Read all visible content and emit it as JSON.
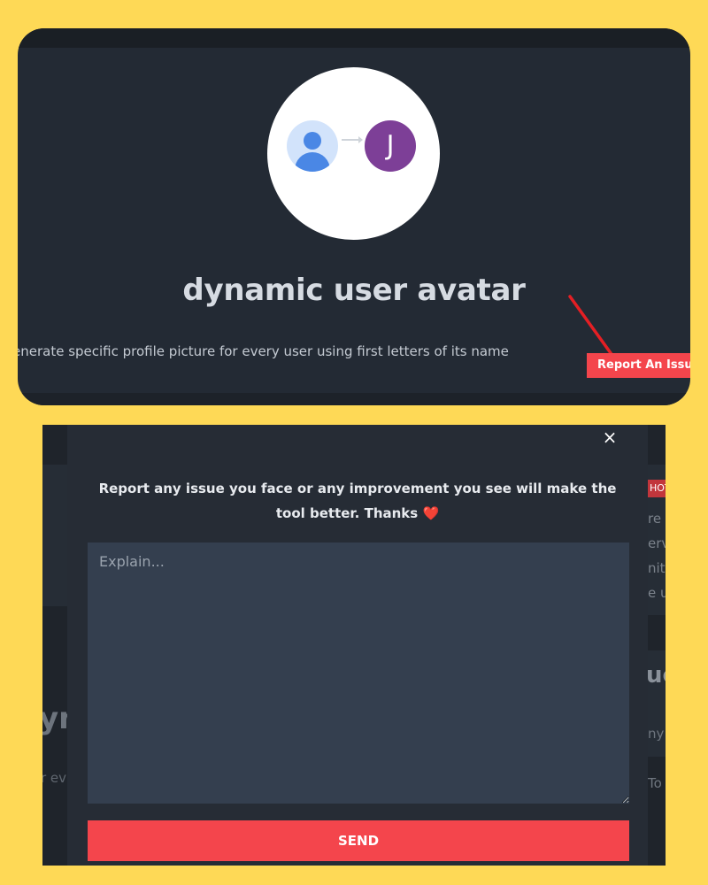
{
  "tool_card": {
    "title": "dynamic user avatar",
    "description": "enerate specific profile picture for every user using first letters of its name",
    "logo_letter": "J",
    "report_button_label": "Report An Issue"
  },
  "background_page": {
    "hot_badge": "HOT",
    "right_fragments": [
      "re",
      "erv",
      "nit",
      "e u"
    ],
    "right_heading_fragment": "uc",
    "right_text_fragment": "ny",
    "right_text_fragment2": "To",
    "left_heading_fragment": "yn",
    "left_text_fragment": "r ev"
  },
  "report_modal": {
    "close_symbol": "×",
    "message": "Report any issue you face or any improvement you see will make the tool better. Thanks",
    "heart": "❤️",
    "textarea_placeholder": "Explain...",
    "send_label": "SEND"
  },
  "colors": {
    "page_background": "#fed956",
    "card_background": "#232a34",
    "accent_red": "#f4454c",
    "avatar_purple": "#7d3f97",
    "avatar_blue": "#4a87e5"
  }
}
